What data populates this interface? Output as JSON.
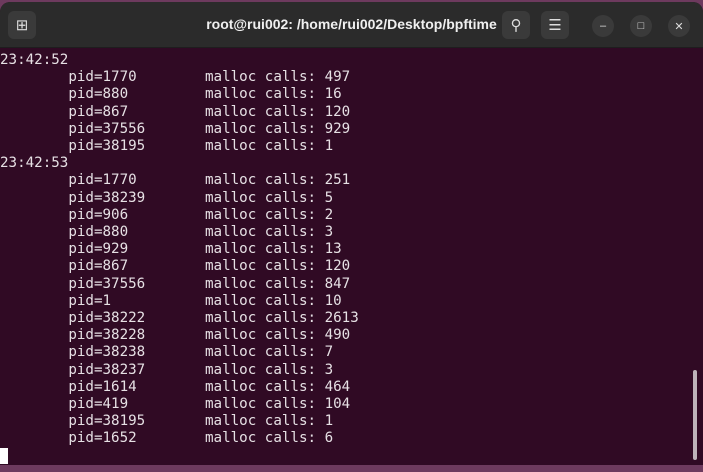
{
  "window": {
    "title": "root@rui002: /home/rui002/Desktop/bpftime"
  },
  "icons": {
    "new_tab": "new-tab-icon",
    "search": "search-icon",
    "menu": "hamburger-menu-icon",
    "minimize": "minimize-icon",
    "maximize": "maximize-icon",
    "close": "close-icon"
  },
  "colors": {
    "terminal_bg": "#300a24",
    "titlebar_bg": "#2b2b2b",
    "text": "#e6e0e4"
  },
  "label": "malloc calls: ",
  "blocks": [
    {
      "time": "23:42:52",
      "rows": [
        [
          "1770",
          "497"
        ],
        [
          "880",
          "16"
        ],
        [
          "867",
          "120"
        ],
        [
          "37556",
          "929"
        ],
        [
          "38195",
          "1"
        ]
      ]
    },
    {
      "time": "23:42:53",
      "rows": [
        [
          "1770",
          "251"
        ],
        [
          "38239",
          "5"
        ],
        [
          "906",
          "2"
        ],
        [
          "880",
          "3"
        ],
        [
          "929",
          "13"
        ],
        [
          "867",
          "120"
        ],
        [
          "37556",
          "847"
        ],
        [
          "1",
          "10"
        ],
        [
          "38222",
          "2613"
        ],
        [
          "38228",
          "490"
        ],
        [
          "38238",
          "7"
        ],
        [
          "38237",
          "3"
        ],
        [
          "1614",
          "464"
        ],
        [
          "419",
          "104"
        ],
        [
          "38195",
          "1"
        ],
        [
          "1652",
          "6"
        ]
      ]
    }
  ]
}
